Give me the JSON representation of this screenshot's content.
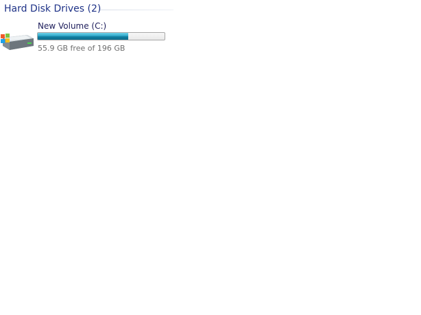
{
  "group": {
    "title": "Hard Disk Drives (2)"
  },
  "drives": [
    {
      "name": "New Volume (C:)",
      "free_text": "55.9 GB free of 196 GB",
      "used_fraction": 0.715,
      "icon": "hard-drive-windows-icon"
    }
  ],
  "colors": {
    "header_text": "#1e3287",
    "bar_fill": "#1f9ac0",
    "free_text": "#6d6d6d"
  }
}
